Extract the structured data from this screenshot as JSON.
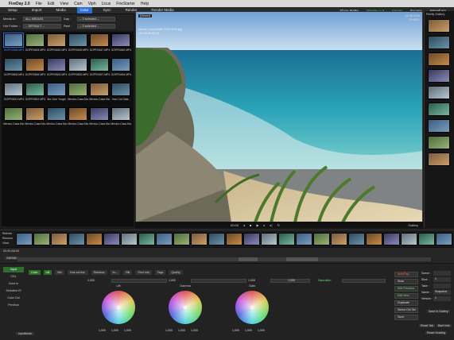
{
  "menubar": {
    "app": "FireDay 2.0",
    "items": [
      "File",
      "Edit",
      "View",
      "Cam",
      "Viph",
      "Licus",
      "FireStarter",
      "Help"
    ]
  },
  "toolbar": {
    "tabs": [
      "Setup",
      "Import",
      "Media",
      "Color",
      "Sync",
      "Render",
      "Render Media"
    ],
    "active_tab": "Color",
    "right": [
      "Show Matte",
      "Display Lut",
      "Import",
      "Bypass",
      "Waveform"
    ],
    "right_green": "Display Lut"
  },
  "filters": {
    "media_in_label": "Media In:",
    "media_in_value": "ALL MEDIAS",
    "day_label": "Day :",
    "day_value": "-- 0 selected --",
    "hot_folder_label": "Hot Folder :",
    "hot_folder_value": "-- DEFAULT --",
    "reel_label": "Reel :",
    "reel_value": "-- 0 selected --"
  },
  "grid": {
    "rows": [
      [
        "GOPR0458.MP4",
        "GOPR0453.MP4",
        "GOPR0452.MP4",
        "GOPR0449.MP4",
        "GOPR0447.MP4",
        "GOPR0440.MP4"
      ],
      [
        "GOPR0505.MP4",
        "GOPR0508.MP4",
        "GOPR0503.MP4",
        "GOPR0500.MP4",
        "GOPR0497.MP4",
        "GOPR0494.MP4"
      ],
      [
        "GOPR0511.MP4",
        "GOPR0502.MP4",
        "Ibo-York Yough.",
        "Mexico-Casa Ma.",
        "Mexico-Casa Ma.",
        "Inco-Cal Sala..."
      ],
      [
        "Mexico-Casa Ma.",
        "Mexico-Casa Ma.",
        "Mexico-Casa Ma.",
        "Mexico-Casa Ma.",
        "Mexico-Casa Ma.",
        "Mexico-Casa Ma."
      ]
    ]
  },
  "viewer": {
    "caption": "[Viewer]",
    "clip_title": "Mexico-Casa Matte 2016 9294.jpg",
    "clip_sub": "100 00:00:05:25",
    "date": "01-05-2016",
    "frame_id": "23HDR1",
    "play_timecode": "00:00",
    "gallery_label": "Gallery"
  },
  "gallery": {
    "title": "Firefly Gallery",
    "items": 9
  },
  "filmstrip": {
    "buttons": [
      "Refresh",
      "Remove",
      "Clear"
    ],
    "thumbs": 25
  },
  "midstrip": {
    "timecode": "02:00:48:00",
    "frame": "236368"
  },
  "panel": {
    "left_buttons": [
      "Input",
      "CDL",
      "Color In",
      "Selective Ef",
      "Color Out",
      "Pen/Iron"
    ],
    "tabs": [
      "Color",
      "Lift",
      "Mix",
      "Hue correct.",
      "Rainbow",
      "Ilu...",
      "Blk",
      "Shot Info",
      "Tags",
      "Quality"
    ],
    "active_tab": "Lift",
    "bottom_button": "InputMode",
    "saturation_label": "Saturation",
    "wheels": [
      {
        "label": "Lift",
        "value_left": "1,000",
        "value_right": "1,000"
      },
      {
        "label": "Gamma",
        "value_left": "1,000",
        "value_right": "1,000"
      },
      {
        "label": "Gain",
        "value_left": "1,000",
        "value_right": "1,000"
      }
    ],
    "row_values": [
      "1,000",
      "1,000",
      "1,000",
      "1,000"
    ],
    "wheel_bottom_values": [
      [
        "1,000",
        "1,000",
        "1,000"
      ],
      [
        "1,000",
        "1,000",
        "1,000"
      ],
      [
        "1,000",
        "1,000",
        "1,000"
      ]
    ],
    "right_buttons": [
      {
        "label": "AutoPlay",
        "style": "red"
      },
      {
        "label": "Scan",
        "style": "normal"
      },
      {
        "label": "Edit Previous",
        "style": "green"
      },
      {
        "label": "Edit Next",
        "style": "green"
      },
      {
        "label": "Duplicate",
        "style": "normal"
      },
      {
        "label": "Select  Ctrl Sel",
        "style": "normal"
      },
      {
        "label": "Save",
        "style": "normal"
      }
    ],
    "right_fields": [
      {
        "label": "Scene :",
        "value": ""
      },
      {
        "label": "Shot :",
        "value": "1"
      },
      {
        "label": "Take :",
        "value": ""
      },
      {
        "label": "Name :",
        "value": "Snapshot"
      },
      {
        "label": "Version :",
        "value": "1"
      }
    ],
    "save_gallery": "Save In Gallery",
    "reset_tab": "Reset Tab",
    "bad_hole": "Bad Hole",
    "reset_grading": "Reset Grading"
  }
}
